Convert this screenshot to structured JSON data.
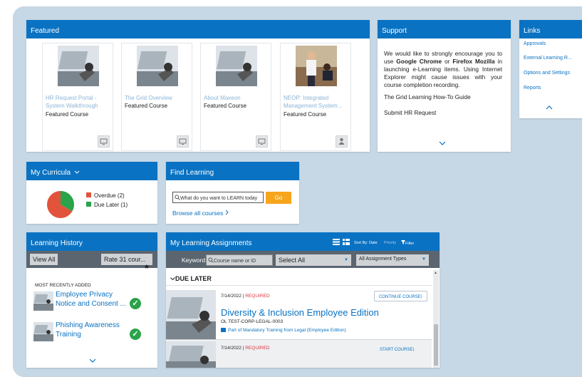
{
  "featured": {
    "header": "Featured",
    "tiles": [
      {
        "title1": "HR Request Portal -",
        "title2": "System Walkthrough",
        "type": "Featured Course"
      },
      {
        "title1": "The Grid Overview",
        "title2": "",
        "type": "Featured Course"
      },
      {
        "title1": "About Maxeon",
        "title2": "",
        "type": "Featured Course"
      },
      {
        "title1": "NEOP: Integrated",
        "title2": "Management System...",
        "type": "Featured Course"
      }
    ]
  },
  "support": {
    "header": "Support",
    "text_parts": [
      "We would like to strongly encourage you to use ",
      "Google Chrome",
      " or ",
      "Firefox Mozilla",
      " in launching e-Learning items. Using Internet Explorer might cause issues with your course completion recording."
    ],
    "links": [
      "The Grid Learning How-To Guide",
      "Submit HR Request"
    ]
  },
  "links_panel": {
    "header": "Links",
    "items": [
      "Approvals",
      "External Learning R...",
      "Options and Settings",
      "Reports"
    ]
  },
  "curricula": {
    "header": "My Curricula",
    "legend": [
      {
        "label": "Overdue (2)",
        "color": "#e2533b"
      },
      {
        "label": "Due Later (1)",
        "color": "#2aa34a"
      }
    ],
    "chart_values": [
      2,
      1
    ]
  },
  "find_learning": {
    "header": "Find Learning",
    "placeholder": "What do you want to LEARN today",
    "go_label": "Go",
    "browse_label": "Browse all courses"
  },
  "history": {
    "header": "Learning History",
    "view_all": "View All",
    "rate_label": "Rate 31 cour...",
    "section_label": "MOST RECENTLY ADDED",
    "items": [
      {
        "line1": "Employee Privacy",
        "line2": "Notice and Consent ..."
      },
      {
        "line1": "Phishing Awareness",
        "line2": "Training"
      }
    ]
  },
  "assignments": {
    "header": "My Learning Assignments",
    "sort_label": "Sort By: Date",
    "priority_label": "Priority",
    "filter_label": "Filter",
    "keyword_label": "Keyword",
    "keyword_placeholder": "Course name or ID",
    "select_all": "Select All",
    "assignment_types": "All Assignment Types",
    "group_label": "DUE LATER",
    "items": [
      {
        "date": "7/14/2022",
        "status": "REQUIRED",
        "action": "CONTINUE COURSE",
        "title": "Diversity & Inclusion Employee Edition",
        "code": "OL TEST-CORP-LEGAL-0003",
        "part_of": "Part of Mandatory Training from Legal (Employee Edition)"
      },
      {
        "date": "7/14/2022",
        "status": "REQUIRED",
        "action": "START COURSE"
      }
    ]
  },
  "colors": {
    "header_blue": "#0a72c2",
    "background": "#c6d8e6",
    "required_red": "#d9363e",
    "go_orange": "#f7a51c"
  }
}
